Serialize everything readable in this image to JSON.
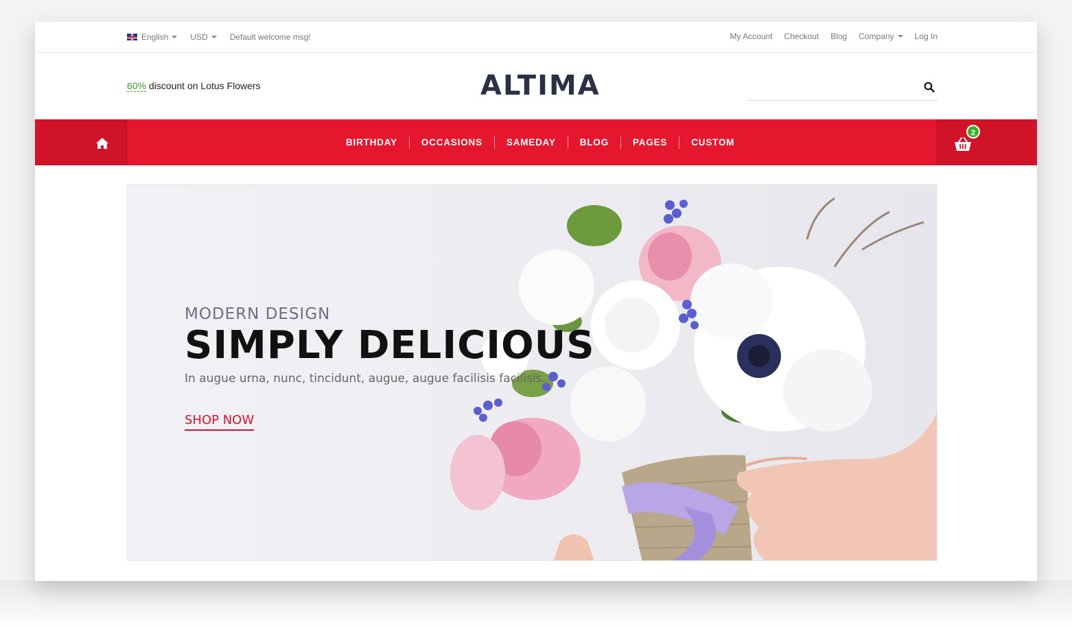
{
  "topbar": {
    "language": "English",
    "currency": "USD",
    "welcome": "Default welcome msg!",
    "links": [
      "My Account",
      "Checkout",
      "Blog",
      "Company",
      "Log In"
    ]
  },
  "header": {
    "promo_pct": "60%",
    "promo_text": " discount on Lotus Flowers",
    "logo": "ALTIMA",
    "search_placeholder": ""
  },
  "nav": {
    "items": [
      "BIRTHDAY",
      "OCCASIONS",
      "SAMEDAY",
      "BLOG",
      "PAGES",
      "CUSTOM"
    ],
    "cart_count": "2"
  },
  "hero": {
    "kicker": "MODERN DESIGN",
    "headline": "SIMPLY DELICIOUS",
    "subline": "In augue urna, nunc, tincidunt, augue, augue facilisis facilisis.",
    "cta": "SHOP NOW"
  },
  "colors": {
    "brand_red": "#e4172f",
    "brand_red_dark": "#d1132a",
    "badge_green": "#3fae29",
    "logo_navy": "#2a3144"
  },
  "icons": [
    "uk-flag-icon",
    "search-icon",
    "home-icon",
    "cart-icon"
  ]
}
